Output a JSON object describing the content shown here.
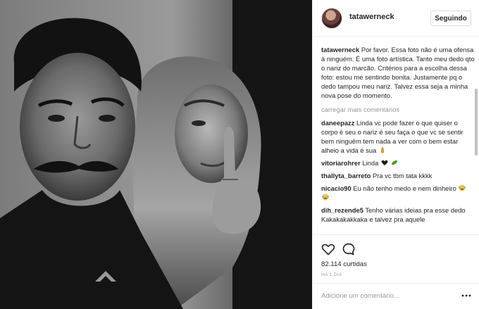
{
  "post": {
    "username": "tatawerneck",
    "follow_label": "Seguindo",
    "caption_user": "tatawerneck",
    "caption_text": "Por favor. Essa foto não é uma ofensa à ninguém. É uma foto artística. Tanto meu dedo qto o nariz do marcão. Critérios para a escolha dessa foto: estou me sentindo bonita. Justamente pq o dedo tampou meu nariz. Talvez essa seja a minha nova pose do momento.",
    "load_more_label": "carregar mais comentários",
    "likes_label": "82.114 curtidas",
    "time_label": "HÁ 1 DIA",
    "comment_placeholder": "Adicione um comentário...",
    "icons": [
      "heart-icon",
      "comment-bubble-icon",
      "more-options-icon"
    ],
    "colors": {
      "text": "#262626",
      "muted": "#999999",
      "border": "#efefef"
    }
  },
  "comments": [
    {
      "user": "daneepazz",
      "text": "Linda vc pode fazer o que quiser o corpo é seu o nariz é seu faça o que vc se sentir bem ninguém tem nada a ver com o bem estar alheio a vida é sua",
      "emoji": "pray-emoji"
    },
    {
      "user": "vitoriarohrer",
      "text": "Linda",
      "emoji": "heart-and-cucumber-emoji"
    },
    {
      "user": "thallyta_barreto",
      "text": "Pra vc tbm tata kkkk",
      "emoji": ""
    },
    {
      "user": "nicacio90",
      "text": "Eu não tenho medo e nem dinheiro",
      "emoji": "crying-laughing-emoji"
    },
    {
      "user": "dih_rezende5",
      "text": "Tenho várias ideias pra esse dedo Kakakakakkaka e talvez pra aquele",
      "emoji": ""
    }
  ]
}
